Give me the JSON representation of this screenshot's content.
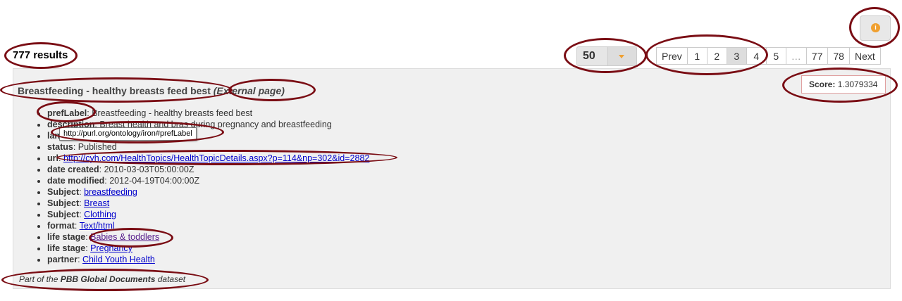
{
  "results_count": "777 results",
  "per_page": {
    "value": "50"
  },
  "pager": {
    "items": [
      "Prev",
      "1",
      "2",
      "3",
      "4",
      "5",
      "…",
      "77",
      "78",
      "Next"
    ],
    "active": "3"
  },
  "info_icon": "info-icon",
  "result": {
    "title": "Breastfeeding - healthy breasts feed best",
    "external": "(External page)",
    "score_label": "Score:",
    "score_value": "1.3079334",
    "properties": [
      {
        "key": "prefLabel",
        "value": "Breastfeeding - healthy breasts feed best",
        "link": false
      },
      {
        "key": "description",
        "value": "Breast health and bras during pregnancy and breastfeeding",
        "link": false
      },
      {
        "key": "language",
        "value": "en",
        "link": false
      },
      {
        "key": "status",
        "value": "Published",
        "link": false
      },
      {
        "key": "url",
        "value": "http://cyh.com/HealthTopics/HealthTopicDetails.aspx?p=114&np=302&id=2882",
        "link": true
      },
      {
        "key": "date created",
        "value": "2010-03-03T05:00:00Z",
        "link": false
      },
      {
        "key": "date modified",
        "value": "2012-04-19T04:00:00Z",
        "link": false
      },
      {
        "key": "Subject",
        "value": "breastfeeding",
        "link": true
      },
      {
        "key": "Subject",
        "value": "Breast",
        "link": true
      },
      {
        "key": "Subject",
        "value": "Clothing",
        "link": true
      },
      {
        "key": "format",
        "value": "Text/html",
        "link": true
      },
      {
        "key": "life stage",
        "value": "Babies & toddlers",
        "link": true,
        "visited": true
      },
      {
        "key": "life stage",
        "value": "Pregnancy",
        "link": true
      },
      {
        "key": "partner",
        "value": "Child Youth Health",
        "link": true
      }
    ],
    "tooltip": "http://purl.org/ontology/iron#prefLabel",
    "dataset_prefix": "Part of the",
    "dataset_name": "PBB Global Documents",
    "dataset_suffix": "dataset"
  },
  "colors": {
    "annotation": "#7a0d14",
    "accent": "#f0a030",
    "link": "#0000cc"
  }
}
